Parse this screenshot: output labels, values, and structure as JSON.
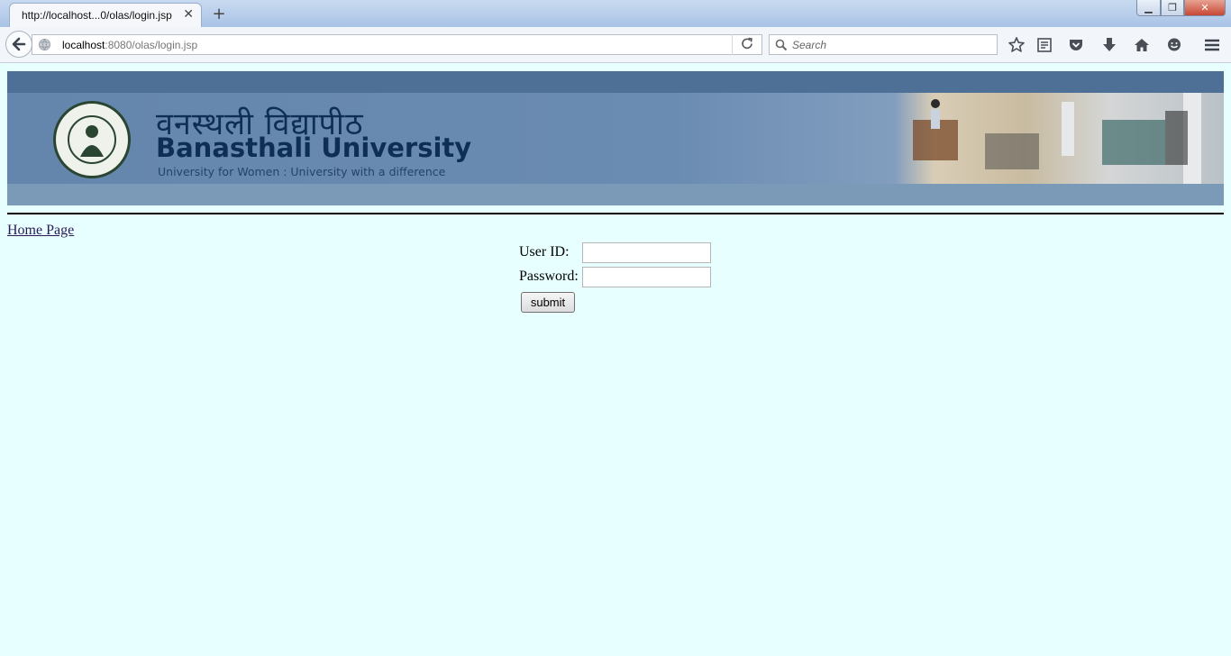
{
  "browser": {
    "tab_title": "http://localhost...0/olas/login.jsp",
    "tab_close_glyph": "✕",
    "new_tab_glyph": "+",
    "window_controls": {
      "minimize": "▁",
      "maximize": "❐",
      "close": "✕"
    },
    "url_host": "localhost",
    "url_path": ":8080/olas/login.jsp",
    "search_placeholder": "Search",
    "icons": [
      "back-arrow-icon",
      "globe-icon",
      "reload-icon",
      "search-icon",
      "bookmark-star-icon",
      "reading-list-icon",
      "pocket-icon",
      "download-icon",
      "home-icon",
      "chat-icon",
      "menu-icon"
    ]
  },
  "banner": {
    "hindi_name": "वनस्थली विद्यापीठ",
    "university_name": "Banasthali University",
    "tagline": "University for Women : University with a difference",
    "colors": {
      "dark": "#4e6f96",
      "mid": "#6485ac",
      "text": "#0f2e55"
    }
  },
  "page": {
    "home_link": "Home Page",
    "form": {
      "userid_label": "User ID:",
      "userid_value": "",
      "password_label": "Password:",
      "password_value": "",
      "submit_label": "submit"
    }
  },
  "colors": {
    "page_background": "#e8ffff",
    "link": "#2a1a58"
  }
}
